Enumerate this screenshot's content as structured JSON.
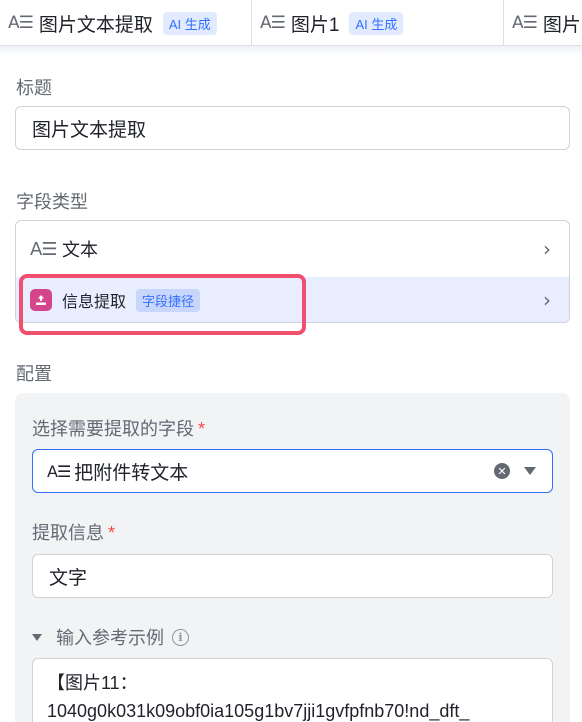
{
  "columns": [
    {
      "icon": "text-field-icon",
      "name": "图片文本提取",
      "badge": "AI 生成"
    },
    {
      "icon": "text-field-icon",
      "name": "图片1",
      "badge": "AI 生成"
    },
    {
      "icon": "text-field-icon",
      "name": "图片"
    }
  ],
  "form": {
    "title_label": "标题",
    "title_value": "图片文本提取",
    "type_label": "字段类型",
    "types": [
      {
        "icon": "text-field-icon",
        "label": "文本"
      },
      {
        "icon": "info-extract-icon",
        "label": "信息提取",
        "badge": "字段捷径"
      }
    ],
    "config_label": "配置"
  },
  "config": {
    "select_label": "选择需要提取的字段",
    "required_mark": "*",
    "select_value": "把附件转文本",
    "info_label": "提取信息",
    "info_value": "文字",
    "reference_label": "输入参考示例",
    "reference_lines": [
      "【图片11：",
      "1040g0k031k09obf0ia105g1bv7jji1gvfpfnb70!nd_dft_"
    ]
  },
  "colors": {
    "accent": "#3370ff",
    "highlight": "#f0506e",
    "required": "#f54a45",
    "extract_icon_bg": "#d4458c"
  }
}
